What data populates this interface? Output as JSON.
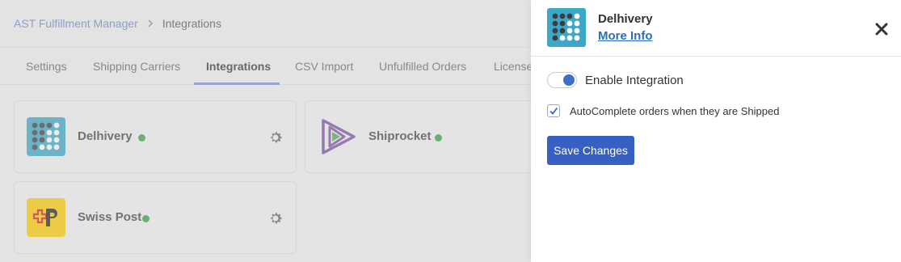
{
  "breadcrumb": {
    "parent": "AST Fulfillment Manager",
    "current": "Integrations",
    "separator_icon": "chevron-right-icon"
  },
  "tabs": [
    {
      "label": "Settings",
      "active": false
    },
    {
      "label": "Shipping Carriers",
      "active": false
    },
    {
      "label": "Integrations",
      "active": true
    },
    {
      "label": "CSV Import",
      "active": false
    },
    {
      "label": "Unfulfilled Orders",
      "active": false
    },
    {
      "label": "License",
      "active": false
    }
  ],
  "integrations": [
    {
      "name": "Delhivery",
      "status_color": "#3aa14a",
      "icon": "delhivery-logo"
    },
    {
      "name": "Shiprocket",
      "status_color": "#3aa14a",
      "icon": "shiprocket-logo"
    },
    {
      "name": "Swiss Post",
      "status_color": "#3aa14a",
      "icon": "swiss-post-logo"
    }
  ],
  "panel": {
    "title": "Delhivery",
    "link": "More Info",
    "toggle_label": "Enable Integration",
    "toggle_on": true,
    "checkbox_label": "AutoComplete orders when they are Shipped",
    "checkbox_checked": true,
    "save_label": "Save Changes"
  },
  "colors": {
    "accent": "#3660c4",
    "link": "#2a6ebd",
    "status_green": "#3aa14a",
    "tab_underline": "#7e8dd3"
  }
}
